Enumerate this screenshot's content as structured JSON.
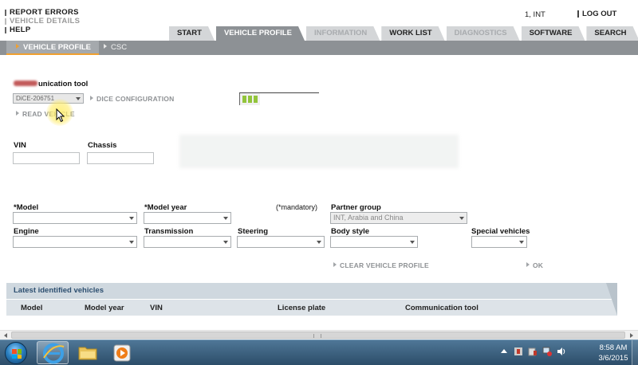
{
  "top_menu": {
    "report_errors": "REPORT ERRORS",
    "vehicle_details": "VEHICLE DETAILS",
    "help": "HELP",
    "user": "1, INT",
    "logout": "LOG OUT"
  },
  "tabs": [
    {
      "label": "START",
      "state": "normal"
    },
    {
      "label": "VEHICLE PROFILE",
      "state": "active"
    },
    {
      "label": "INFORMATION",
      "state": "disabled"
    },
    {
      "label": "WORK LIST",
      "state": "normal"
    },
    {
      "label": "DIAGNOSTICS",
      "state": "disabled"
    },
    {
      "label": "SOFTWARE",
      "state": "normal"
    },
    {
      "label": "SEARCH",
      "state": "normal"
    }
  ],
  "subnav": {
    "active": "VEHICLE PROFILE",
    "other": "CSC"
  },
  "comm": {
    "label": "unication tool",
    "dice_value": "DiCE-206751",
    "dice_config": "DICE CONFIGURATION",
    "read_vehicle": "READ VEHICLE",
    "progress_segments": 3
  },
  "fields": {
    "vin": "VIN",
    "chassis": "Chassis",
    "model": "*Model",
    "model_year": "*Model year",
    "mandatory": "(*mandatory)",
    "partner_group": "Partner group",
    "partner_group_value": "INT, Arabia and China",
    "engine": "Engine",
    "transmission": "Transmission",
    "steering": "Steering",
    "body_style": "Body style",
    "special_vehicles": "Special vehicles"
  },
  "actions": {
    "clear": "CLEAR VEHICLE PROFILE",
    "ok": "OK"
  },
  "latest": {
    "title": "Latest identified vehicles",
    "columns": [
      "Model",
      "Model year",
      "VIN",
      "License plate",
      "Communication tool"
    ]
  },
  "taskbar": {
    "time": "8:58 AM",
    "date": "3/6/2015"
  },
  "colors": {
    "active_tab": "#8d9195",
    "accent_orange": "#f0a030",
    "progress_green": "#92c43b",
    "latest_header": "#cfd8df"
  }
}
